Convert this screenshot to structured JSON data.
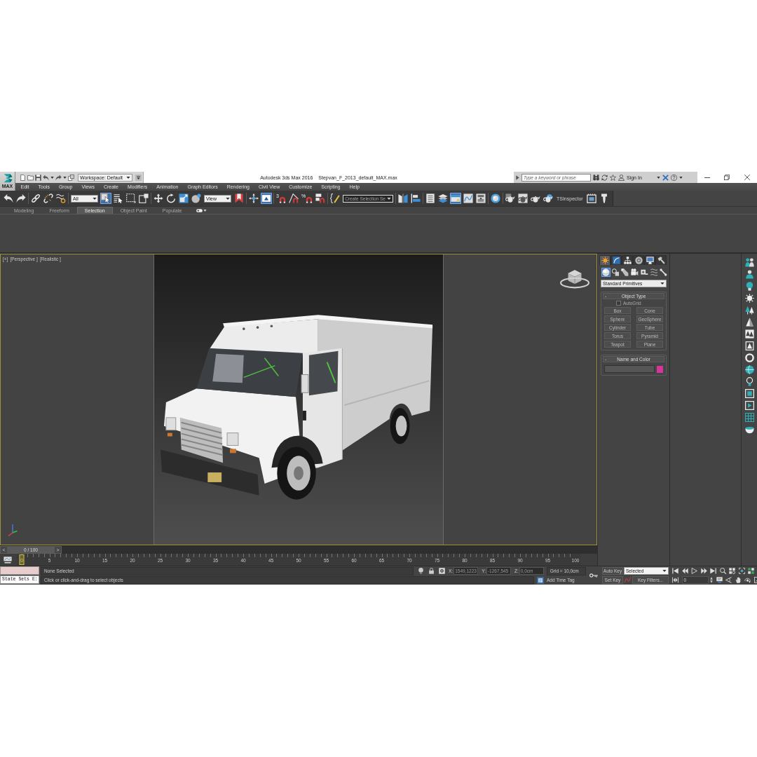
{
  "title_bar": {
    "logo": "MAX",
    "workspace": "Workspace: Default",
    "app_title": "Autodesk 3ds Max 2016",
    "file_name": "Stepvan_F_2013_default_MAX.max",
    "search": {
      "placeholder": "Type a keyword or phrase"
    },
    "sign_in": "Sign In"
  },
  "menu": [
    "Edit",
    "Tools",
    "Group",
    "Views",
    "Create",
    "Modifiers",
    "Animation",
    "Graph Editors",
    "Rendering",
    "Civil View",
    "Customize",
    "Scripting",
    "Help"
  ],
  "main_toolbar": [
    [
      {
        "kind": "button",
        "active": false
      },
      {
        "kind": "button",
        "active": false
      }
    ],
    [
      {
        "kind": "button",
        "active": false
      },
      {
        "kind": "button",
        "active": false
      },
      {
        "kind": "button",
        "active": false
      }
    ],
    [
      {
        "kind": "dropdown",
        "value": "All"
      },
      {
        "kind": "button",
        "active": true
      },
      {
        "kind": "button",
        "active": false
      },
      {
        "kind": "button",
        "active": false
      },
      {
        "kind": "button",
        "active": false
      }
    ],
    [
      {
        "kind": "button",
        "active": false
      },
      {
        "kind": "button",
        "active": false
      },
      {
        "kind": "button",
        "active": false
      },
      {
        "kind": "button",
        "active": false
      },
      {
        "kind": "dropdown",
        "value": "View"
      },
      {
        "kind": "button",
        "active": false
      }
    ],
    [
      {
        "kind": "button",
        "active": false
      },
      {
        "kind": "button",
        "active": true
      }
    ],
    [
      {
        "kind": "button",
        "active": false,
        "glyph": "3"
      },
      {
        "kind": "button",
        "active": false
      },
      {
        "kind": "button",
        "active": false,
        "glyph": "%"
      },
      {
        "kind": "button",
        "active": false
      }
    ],
    [
      {
        "kind": "button",
        "active": false
      },
      {
        "kind": "combo",
        "value": "Create Selection Se"
      }
    ],
    [
      {
        "kind": "button",
        "active": false
      },
      {
        "kind": "button",
        "active": false
      }
    ],
    [
      {
        "kind": "button",
        "active": false
      },
      {
        "kind": "button",
        "active": false
      },
      {
        "kind": "button",
        "active": true
      },
      {
        "kind": "button",
        "active": false
      },
      {
        "kind": "button",
        "active": false
      }
    ],
    [
      {
        "kind": "button",
        "active": false
      }
    ],
    [
      {
        "kind": "button",
        "active": false
      },
      {
        "kind": "button",
        "active": false
      },
      {
        "kind": "button",
        "active": false
      },
      {
        "kind": "button",
        "active": false
      },
      {
        "kind": "label",
        "text": "TSInspector"
      },
      {
        "kind": "button",
        "active": false
      },
      {
        "kind": "button",
        "active": false
      }
    ]
  ],
  "ribbon": {
    "tabs": [
      {
        "label": "Modeling",
        "selected": false
      },
      {
        "label": "Freeform",
        "selected": false
      },
      {
        "label": "Selection",
        "selected": true
      },
      {
        "label": "Object Paint",
        "selected": false
      },
      {
        "label": "Populate",
        "selected": false
      }
    ]
  },
  "viewport": {
    "menus": [
      "[+]",
      "[Perspective ]",
      "[Realistic ]"
    ]
  },
  "command_panel": {
    "tabs": [
      {
        "selected": true
      },
      {
        "selected": false
      },
      {
        "selected": false
      },
      {
        "selected": false
      },
      {
        "selected": false
      },
      {
        "selected": false
      }
    ],
    "categories": [
      {
        "selected": true
      },
      {
        "selected": false
      },
      {
        "selected": false
      },
      {
        "selected": false
      },
      {
        "selected": false
      },
      {
        "selected": false
      },
      {
        "selected": false
      }
    ],
    "object_class": "Standard Primitives",
    "object_type": {
      "toggle": "-",
      "title": "Object Type",
      "autogrid": {
        "label": "AutoGrid",
        "checked": false
      },
      "buttons": [
        "Box",
        "Cone",
        "Sphere",
        "GeoSphere",
        "Cylinder",
        "Tube",
        "Torus",
        "Pyramid",
        "Teapot",
        "Plane"
      ]
    },
    "name_and_color": {
      "toggle": "-",
      "title": "Name and Color",
      "color": "#d6359a"
    }
  },
  "time_slider": {
    "previous": "<",
    "position": "0 / 100",
    "next": ">"
  },
  "track_bar": {
    "labels": [
      "0",
      "5",
      "10",
      "15",
      "20",
      "25",
      "30",
      "35",
      "40",
      "45",
      "50",
      "55",
      "60",
      "65",
      "70",
      "75",
      "80",
      "85",
      "90",
      "95",
      "100"
    ]
  },
  "status_bar": {
    "state_sets": "State Sets E:",
    "selection": "None Selected",
    "coordinates": [
      {
        "axis": "X:",
        "value": "1549,1223"
      },
      {
        "axis": "Y:",
        "value": "-1267,545"
      },
      {
        "axis": "Z:",
        "value": "0,0cm"
      }
    ],
    "grid": "Grid = 10,0cm",
    "prompt": "Click or click-and-drag to select objects",
    "time_tag": "Add Time Tag"
  },
  "animation": {
    "auto_key": "Auto Key",
    "key_mode": "Selected",
    "set_key": "Set Key",
    "key_filters": "Key Filters...",
    "frame": "0"
  }
}
